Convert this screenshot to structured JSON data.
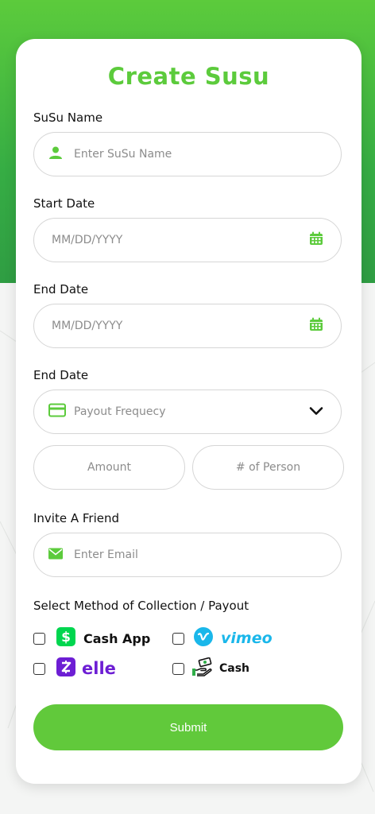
{
  "form": {
    "title": "Create Susu",
    "susu_name": {
      "label": "SuSu Name",
      "placeholder": "Enter SuSu Name"
    },
    "start_date": {
      "label": "Start Date",
      "placeholder": "MM/DD/YYYY"
    },
    "end_date": {
      "label": "End Date",
      "placeholder": "MM/DD/YYYY"
    },
    "payout_frequency": {
      "label": "End Date",
      "placeholder": "Payout Frequecy"
    },
    "amount": {
      "placeholder": "Amount"
    },
    "num_persons": {
      "placeholder": "# of Person"
    },
    "invite": {
      "label": "Invite A Friend",
      "placeholder": "Enter Email"
    },
    "collection": {
      "label": "Select Method of Collection / Payout",
      "methods": [
        {
          "name": "Cash App",
          "icon": "cash-app-icon"
        },
        {
          "name": "vimeo",
          "icon": "vimeo-icon"
        },
        {
          "name": "elle",
          "icon": "zelle-icon"
        },
        {
          "name": "Cash",
          "icon": "cash-hand-icon"
        }
      ]
    },
    "submit_label": "Submit"
  },
  "colors": {
    "brand_green": "#5ccb3c",
    "button_green": "#61c93b",
    "vimeo_blue": "#1ab7ea",
    "zelle_purple": "#6d1ed4",
    "cashapp_green": "#00d64f"
  }
}
